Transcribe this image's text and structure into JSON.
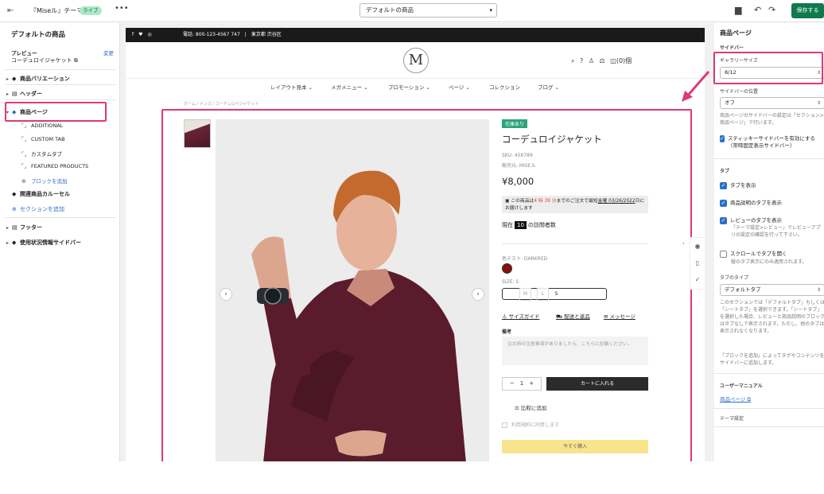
{
  "topbar": {
    "theme_name": "『Miseル』テーマ",
    "live_badge": "ライブ",
    "more": "•••",
    "page_select": "デフォルトの商品",
    "save": "保存する"
  },
  "left": {
    "title": "デフォルトの商品",
    "preview_label": "プレビュー",
    "preview_change": "変更",
    "preview_value": "コーデュロイジャケット",
    "items": [
      {
        "label": "商品バリエーション"
      },
      {
        "label": "ヘッダー"
      },
      {
        "label": "商品ページ"
      },
      {
        "label": "ADDITIONAL"
      },
      {
        "label": "CUSTOM TAB"
      },
      {
        "label": "カスタムタブ"
      },
      {
        "label": "FEATURED PRODUCTS"
      },
      {
        "label": "ブロックを追加"
      },
      {
        "label": "関連商品カルーセル"
      },
      {
        "label": "セクションを追加"
      },
      {
        "label": "フッター"
      },
      {
        "label": "使用状況情報サイドバー"
      }
    ]
  },
  "store": {
    "announcement_left": "電話: 800-123-4567 747　|　東京都 渋谷区",
    "announcement_right": "f　♥　◎",
    "logo": "M",
    "cart_count": "(0)個",
    "nav": [
      "レイアウト見本 ⌄",
      "メガメニュー ⌄",
      "プロモーション ⌄",
      "ページ ⌄",
      "コレクション",
      "ブログ ⌄"
    ],
    "breadcrumb": "ホーム / メンズ / コーデュロイジャケット",
    "stock_badge": "在庫あり",
    "title": "コーデュロイジャケット",
    "sku": "SKU: 456789",
    "vendor": "販売元: MISEル",
    "price": "¥8,000",
    "ship_1": "この商品は",
    "ship_timer": "4 時 39 分",
    "ship_2": "までのご注文で最短",
    "ship_date": "金曜 03/26/2022",
    "ship_3": "日にお届けします",
    "visitors_pre": "現在",
    "visitors_n": "10",
    "visitors_post": "の訪問者数",
    "color_label": "色テスト: DARKRED",
    "size_label": "SIZE: S",
    "sizes": [
      "S",
      "M",
      "L"
    ],
    "size_guide": "サイズガイド",
    "shipping_returns": "配送と返品",
    "message": "メッセージ",
    "note_label": "備考",
    "note_placeholder": "注文時の注意事項がありましたら、こちらに記載ください。",
    "qty": "−　1　+",
    "add_to_cart": "カートに入れる",
    "compare": "比較に追加",
    "agree": "利用規約に同意します",
    "buy_now": "今すぐ購入"
  },
  "right": {
    "title": "商品ページ",
    "sidebar": "サイドバー",
    "gallery_size_label": "ギャラリーサイズ",
    "gallery_size_value": "8/12",
    "sidebar_pos_label": "サイドバーの位置",
    "sidebar_pos_value": "オフ",
    "sidebar_note": "商品ページのサイドバーの設定は「セクション>商品ページ」で行います。",
    "sticky_label": "スティッキーサイドバーを有効にする（常時固定表示サイドバー）",
    "tabs_header": "タブ",
    "show_tabs": "タブを表示",
    "desc_tab": "商品説明のタブを表示",
    "review_tab": "レビューのタブを表示",
    "review_note": "「テーマ設定>レビュー」でレビューアプリの設定の確認を行って下さい。",
    "scroll_tabs": "スクロールでタブを開く",
    "scroll_note": "縦のタブ表示にのみ適用されます。",
    "tab_type_label": "タブのタイプ",
    "tab_type_value": "デフォルトタブ",
    "tab_type_note": "このセクションでは「デフォルトタブ」もしくは「シートタブ」を選択できます。「シートタブ」を選択した場合、レビューと商品説明のブロックはタブなしで表示されます。ただし、他のタブは表示されなくなります。",
    "block_note": "「ブロックを追加」によってタグやコンテンツをサイドバーに追加します。",
    "manual_header": "ユーザーマニュアル",
    "manual_link": "商品ページ ⧉",
    "theme_settings": "テーマ設定"
  },
  "colors": {
    "accent": "#e0387a",
    "save": "#0f7a4b",
    "link": "#2c6ecb"
  }
}
